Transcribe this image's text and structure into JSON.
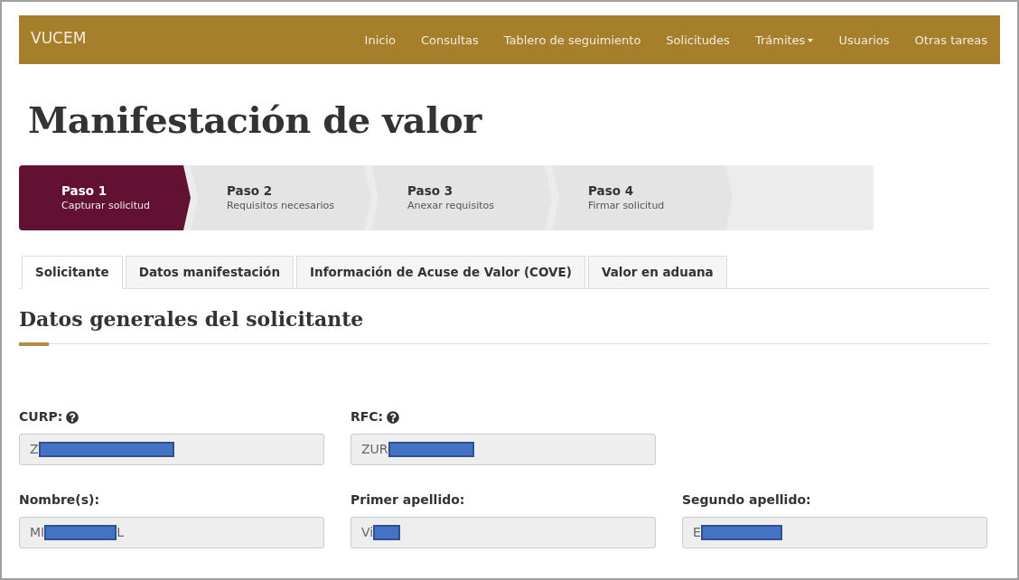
{
  "navbar": {
    "brand": "VUCEM",
    "items": [
      {
        "label": "Inicio",
        "dropdown": false
      },
      {
        "label": "Consultas",
        "dropdown": false
      },
      {
        "label": "Tablero de seguimiento",
        "dropdown": false
      },
      {
        "label": "Solicitudes",
        "dropdown": false
      },
      {
        "label": "Trámites",
        "dropdown": true
      },
      {
        "label": "Usuarios",
        "dropdown": false
      },
      {
        "label": "Otras tareas",
        "dropdown": false
      }
    ]
  },
  "title": "Manifestación de valor",
  "steps": [
    {
      "title": "Paso 1",
      "subtitle": "Capturar solicitud",
      "selected": true
    },
    {
      "title": "Paso 2",
      "subtitle": "Requisitos necesarios",
      "selected": false
    },
    {
      "title": "Paso 3",
      "subtitle": "Anexar requisitos",
      "selected": false
    },
    {
      "title": "Paso 4",
      "subtitle": "Firmar solicitud",
      "selected": false
    }
  ],
  "tabs": [
    {
      "label": "Solicitante",
      "selected": true
    },
    {
      "label": "Datos manifestación",
      "selected": false
    },
    {
      "label": "Información de Acuse de Valor (COVE)",
      "selected": false
    },
    {
      "label": "Valor en aduana",
      "selected": false
    }
  ],
  "section_title": "Datos generales del solicitante",
  "field_rows": [
    [
      {
        "label": "CURP:",
        "help": true,
        "value": "Z",
        "redacted": true
      },
      {
        "label": "RFC:",
        "help": true,
        "value": "ZUR",
        "redacted": true
      }
    ],
    [
      {
        "label": "Nombre(s):",
        "help": false,
        "value": "MI",
        "redacted": true,
        "tail": "L"
      },
      {
        "label": "Primer apellido:",
        "help": false,
        "value": "Vi",
        "redacted": true
      },
      {
        "label": "Segundo apellido:",
        "help": false,
        "value": "E",
        "redacted": true
      }
    ]
  ]
}
